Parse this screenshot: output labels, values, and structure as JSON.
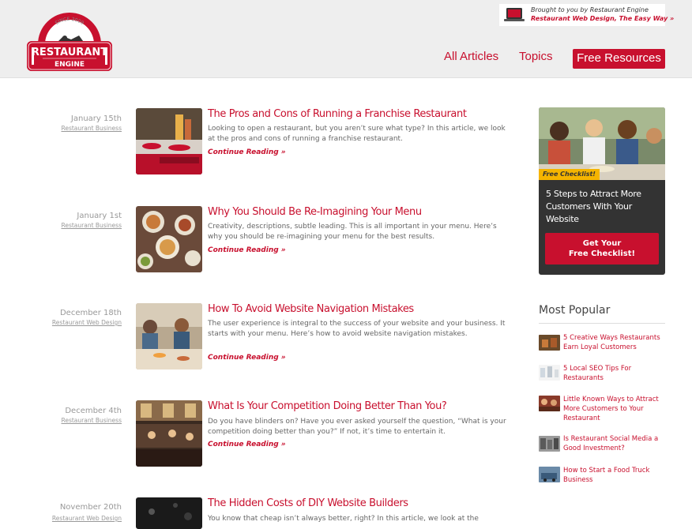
{
  "header": {
    "logo": {
      "arc_text": "SINCE 2009",
      "word1": "RESTAURANT",
      "word2": "ENGINE"
    },
    "sponsor": {
      "line1": "Brought to you by Restaurant Engine",
      "line2": "Restaurant Web Design, The Easy Way »"
    },
    "nav": {
      "articles": "All Articles",
      "topics": "Topics",
      "resources": "Free Resources"
    }
  },
  "articles": [
    {
      "date": "January 15th",
      "category": "Restaurant Business",
      "title": "The Pros and Cons of Running a Franchise Restaurant",
      "excerpt": "Looking to open a restaurant, but you aren’t sure what type? In this article, we look at the pros and cons of running a franchise restaurant.",
      "more": "Continue Reading »"
    },
    {
      "date": "January 1st",
      "category": "Restaurant Business",
      "title": "Why You Should Be Re-Imagining Your Menu",
      "excerpt": "Creativity, descriptions, subtle leading. This is all important in your menu. Here’s why you should be re-imagining your menu for the best results.",
      "more": "Continue Reading »"
    },
    {
      "date": "December 18th",
      "category": "Restaurant Web Design",
      "title": "How To Avoid Website Navigation Mistakes",
      "excerpt": "The user experience is integral to the success of your website and your business. It starts with your menu. Here’s how to avoid website navigation mistakes.",
      "more": "Continue Reading »"
    },
    {
      "date": "December 4th",
      "category": "Restaurant Business",
      "title": "What Is Your Competition Doing Better Than You?",
      "excerpt": "Do you have blinders on? Have you ever asked yourself the question, “What is your competition doing better than you?” If not, it’s time to entertain it.",
      "more": "Continue Reading »"
    },
    {
      "date": "November 20th",
      "category": "Restaurant Web Design",
      "title": "The Hidden Costs of DIY Website Builders",
      "excerpt": "You know that cheap isn’t always better, right? In this article, we look at the",
      "more": ""
    }
  ],
  "sidebar": {
    "promo": {
      "tag": "Free Checklist!",
      "text": "5 Steps to Attract More Customers With Your Website",
      "button_line1": "Get Your",
      "button_line2": "Free Checklist!"
    },
    "popular": {
      "heading": "Most Popular",
      "items": [
        "5 Creative Ways Restaurants Earn Loyal Customers",
        "5 Local SEO Tips For Restaurants",
        "Little Known Ways to Attract More Customers to Your Restaurant",
        "Is Restaurant Social Media a Good Investment?",
        "How to Start a Food Truck Business"
      ]
    }
  }
}
